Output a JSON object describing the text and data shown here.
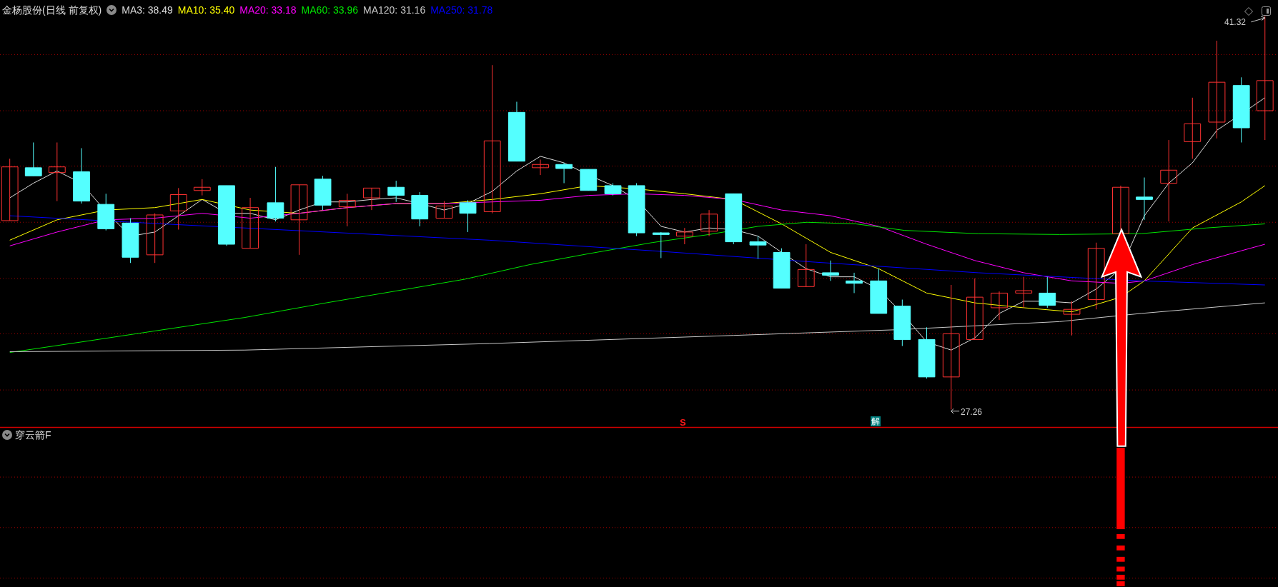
{
  "main_chart": {
    "title": "金杨股份(日线 前复权)",
    "moving_averages": [
      {
        "label": "MA3: 38.49",
        "color": "#dcdcdc"
      },
      {
        "label": "MA10: 35.40",
        "color": "#ffff00"
      },
      {
        "label": "MA20: 33.18",
        "color": "#ff00ff"
      },
      {
        "label": "MA60: 33.96",
        "color": "#00e600"
      },
      {
        "label": "MA120: 31.16",
        "color": "#c8c8c8"
      },
      {
        "label": "MA250: 31.78",
        "color": "#0000ff"
      }
    ],
    "high_label": "41.32",
    "low_label": "27.26",
    "signal_markers": [
      {
        "kind": "sell",
        "text": "S"
      },
      {
        "kind": "unlock",
        "text": "解"
      }
    ]
  },
  "indicator_panel": {
    "title": "穿云箭F"
  }
}
